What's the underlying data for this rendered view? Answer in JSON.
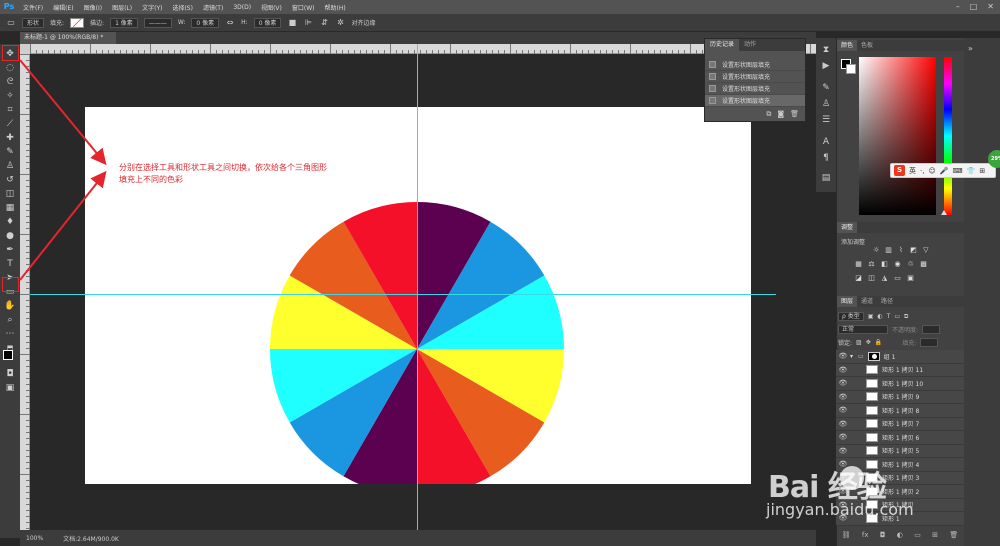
{
  "app": {
    "logo": "Ps",
    "menus": [
      "文件(F)",
      "编辑(E)",
      "图像(I)",
      "图层(L)",
      "文字(Y)",
      "选择(S)",
      "滤镜(T)",
      "3D(D)",
      "视图(V)",
      "窗口(W)",
      "帮助(H)"
    ],
    "window_controls": [
      "–",
      "□",
      "✕"
    ]
  },
  "options": {
    "mode": "形状",
    "fill_label": "填充:",
    "stroke_label": "描边:",
    "stroke_size": "1 像素",
    "w_label": "W:",
    "w_value": "0 像素",
    "h_label": "H:",
    "h_value": "0 像素",
    "align_edges": "对齐边缘"
  },
  "document": {
    "tab_title": "未标题-1 @ 100%(RGB/8) *",
    "annotation_line1": "分别在选择工具和形状工具之间切换，依次给各个三角图形",
    "annotation_line2": "填充上不同的色彩"
  },
  "wheel": {
    "segment_colors": [
      "#5c0050",
      "#1a97e0",
      "#1fffff",
      "#ffff2e",
      "#e85c1e",
      "#f5102a",
      "#5c0050",
      "#1a97e0",
      "#1fffff",
      "#ffff2e",
      "#e85c1e",
      "#f5102a"
    ]
  },
  "status": {
    "zoom": "100%",
    "doc_info": "文档:2.64M/900.0K"
  },
  "history": {
    "tabs": [
      "历史记录",
      "动作"
    ],
    "items": [
      "设置形状图层填充",
      "设置形状图层填充",
      "设置形状图层填充",
      "设置形状图层填充"
    ]
  },
  "color_panel": {
    "tabs": [
      "颜色",
      "色板"
    ]
  },
  "adjustments": {
    "tabs": [
      "调整"
    ],
    "add_label": "添加调整"
  },
  "layers": {
    "tabs": [
      "图层",
      "通道",
      "路径"
    ],
    "filter_kind": "ρ 类型",
    "blend_mode": "正常",
    "opacity_label": "不透明度:",
    "lock_label": "锁定:",
    "fill_label": "填充:",
    "group_name": "组 1",
    "rows": [
      "矩形 1 拷贝 11",
      "矩形 1 拷贝 10",
      "矩形 1 拷贝 9",
      "矩形 1 拷贝 8",
      "矩形 1 拷贝 7",
      "矩形 1 拷贝 6",
      "矩形 1 拷贝 5",
      "矩形 1 拷贝 4",
      "矩形 1 拷贝 3",
      "矩形 1 拷贝 2",
      "矩形 1 拷贝",
      "矩形 1"
    ]
  },
  "ime": {
    "logo": "S",
    "lang": "英"
  },
  "badge": "29%",
  "watermark": {
    "main": "Bai  经验",
    "url": "jingyan.baidu.com"
  },
  "colors": {
    "annotation_red": "#e3252c",
    "guide_cyan": "#36d9e6"
  }
}
